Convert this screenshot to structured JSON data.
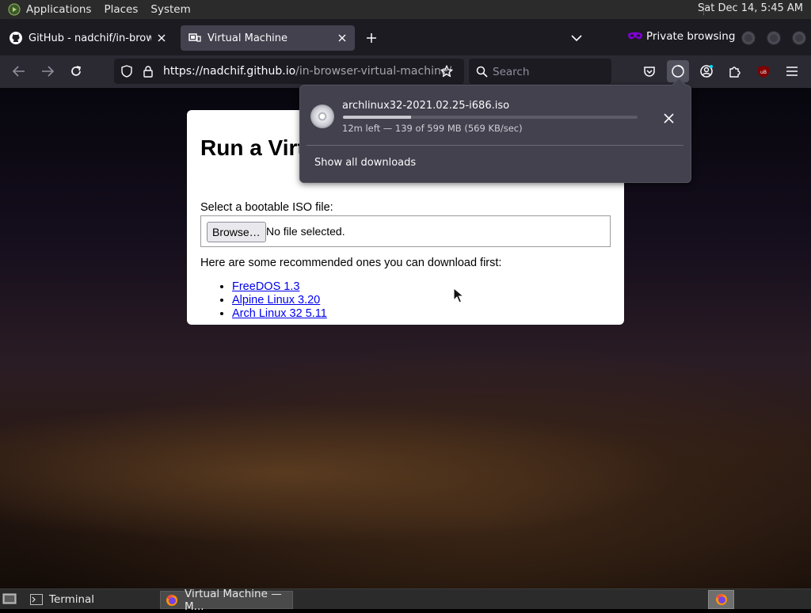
{
  "topbar": {
    "menus": [
      "Applications",
      "Places",
      "System"
    ],
    "clock": "Sat Dec 14,  5:45 AM"
  },
  "tabs": [
    {
      "title": "GitHub - nadchif/in-browser-virtual-machine",
      "icon": "github-icon",
      "active": false
    },
    {
      "title": "Virtual Machine",
      "icon": "vm-favicon-icon",
      "active": true
    }
  ],
  "browser": {
    "private_label": "Private browsing",
    "url_host": "https://nadchif.github.io",
    "url_path": "/in-browser-virtual-machine/",
    "search_placeholder": "Search"
  },
  "page": {
    "heading": "Run a Virtual Machine",
    "iso_label": "Select a bootable ISO file:",
    "browse_label": "Browse…",
    "no_file": "No file selected.",
    "recommend_text": "Here are some recommended ones you can download first:",
    "links": [
      "FreeDOS 1.3",
      "Alpine Linux 3.20",
      "Arch Linux 32 5.11"
    ]
  },
  "download_panel": {
    "filename": "archlinux32-2021.02.25-i686.iso",
    "status": "12m left — 139 of 599 MB (569 KB/sec)",
    "progress_fraction": 0.232,
    "show_all": "Show all downloads"
  },
  "taskbar": {
    "items": [
      {
        "label": "Terminal",
        "icon": "terminal-icon",
        "active": false
      },
      {
        "label": "Virtual Machine — M...",
        "icon": "firefox-icon",
        "active": true
      }
    ]
  },
  "colors": {
    "browser_dark": "#1c1b22",
    "toolbar": "#2b2a33",
    "active_tab": "#42414d",
    "private_purple": "#8000d7",
    "link_blue": "#0000ee"
  }
}
